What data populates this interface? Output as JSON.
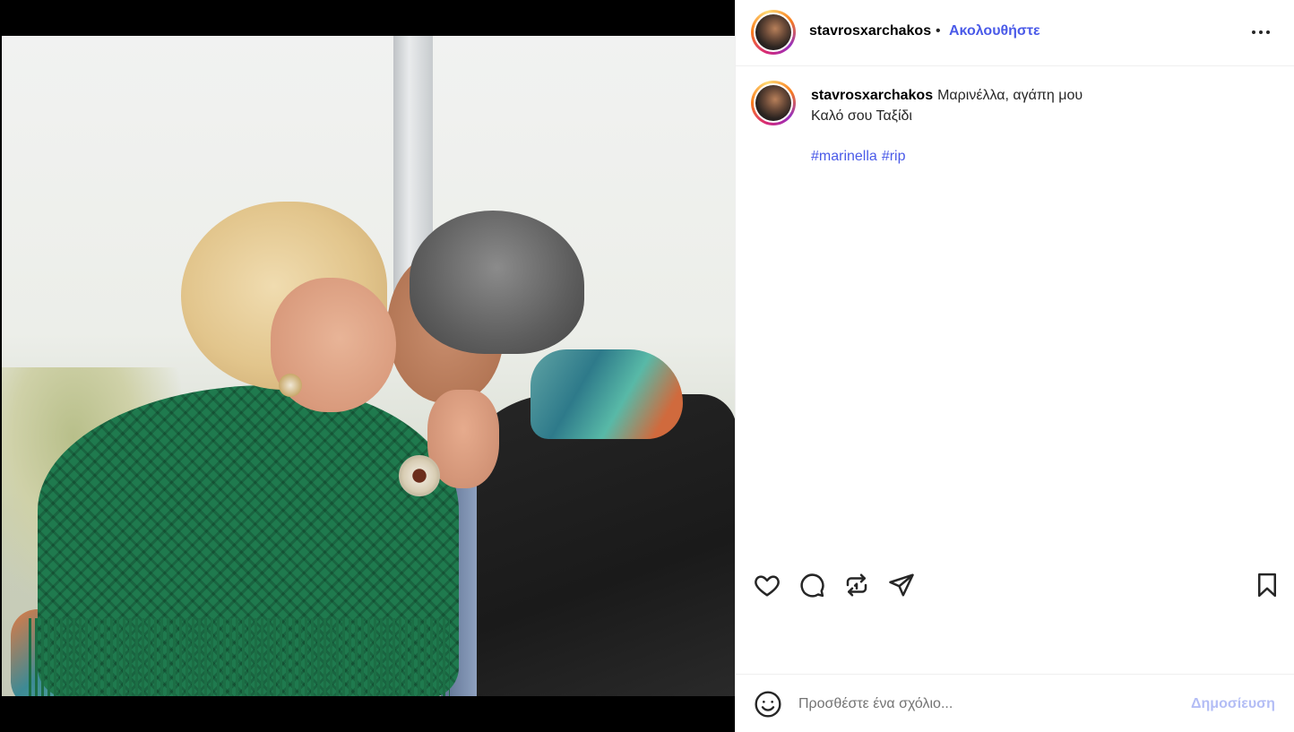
{
  "post": {
    "image_alt_icon": "photo",
    "author": {
      "username": "stavrosxarchakos",
      "separator": "•",
      "follow_label": "Ακολουθήστε"
    },
    "caption": {
      "username": "stavrosxarchakos",
      "line1": "Μαρινέλλα, αγάπη μου",
      "line2": "Καλό σου Ταξίδι",
      "hashtags": [
        "#marinella",
        "#rip"
      ]
    },
    "actions": {
      "like_icon": "heart-icon",
      "comment_icon": "comment-icon",
      "repost_icon": "repost-icon",
      "share_icon": "paper-plane-icon",
      "save_icon": "bookmark-icon"
    },
    "comment_box": {
      "emoji_icon": "smiley-icon",
      "placeholder": "Προσθέστε ένα σχόλιο...",
      "post_label": "Δημοσίευση"
    },
    "colors": {
      "link": "#4a5ae8",
      "post_disabled": "#b3bdf5",
      "divider": "#efefef"
    }
  }
}
